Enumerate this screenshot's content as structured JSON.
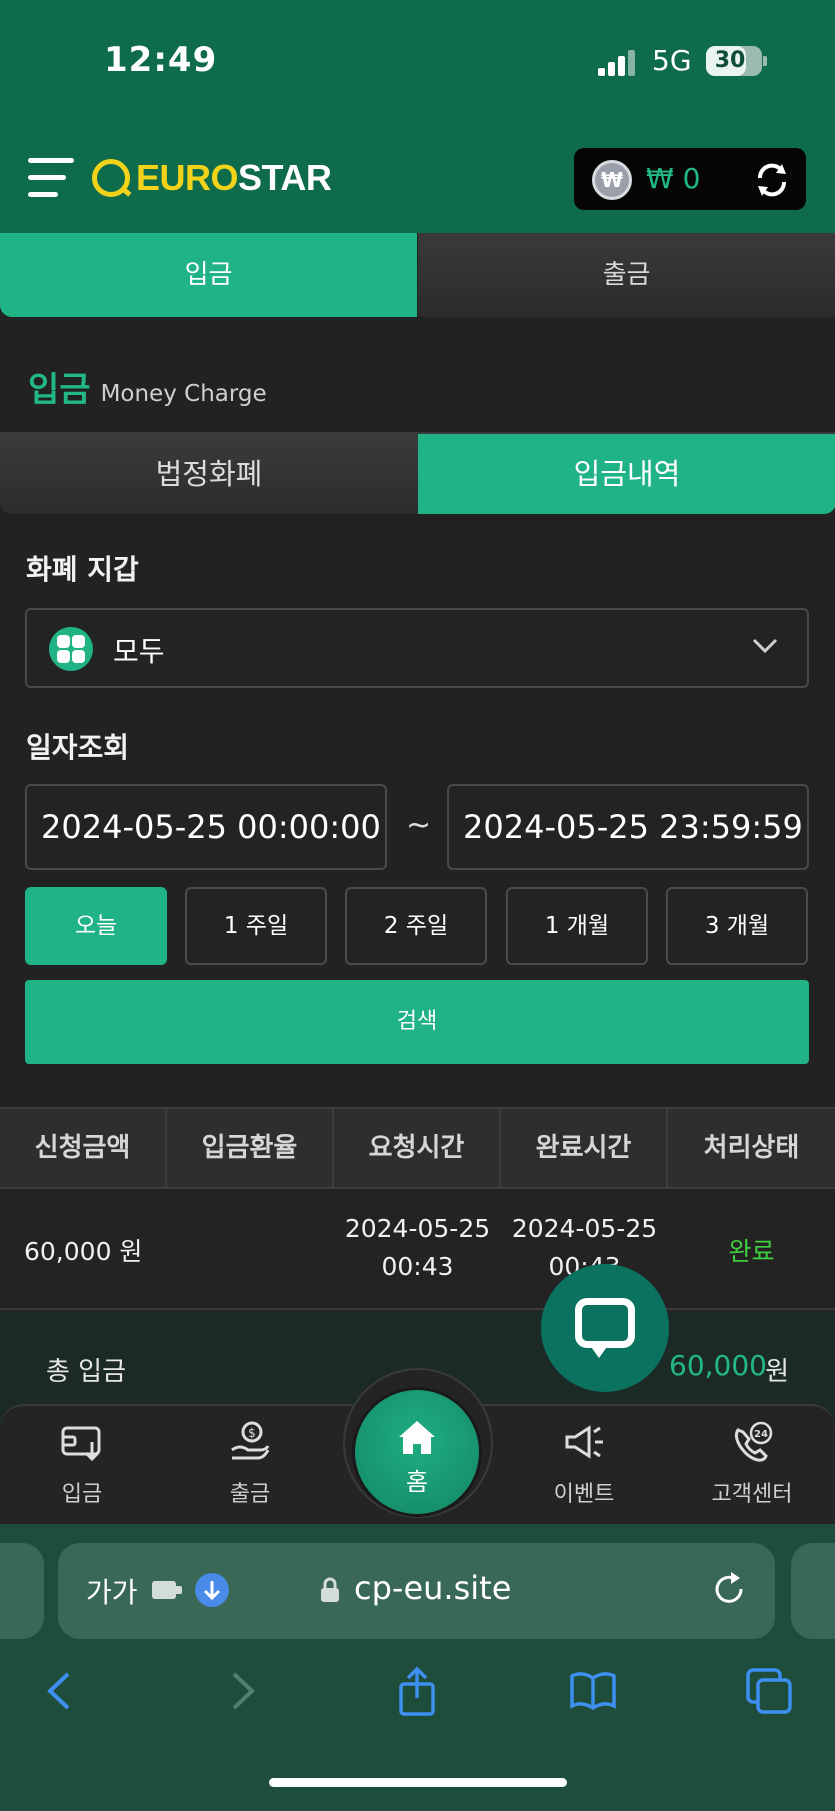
{
  "status_bar": {
    "time": "12:49",
    "network": "5G",
    "battery": "30"
  },
  "header": {
    "logo_part1": "EURO",
    "logo_part2": "STAR",
    "wallet_symbol": "₩",
    "wallet_balance": "₩ 0"
  },
  "tabs": {
    "deposit": "입금",
    "withdraw": "출금"
  },
  "section": {
    "title": "입금",
    "subtitle": "Money Charge"
  },
  "subtabs": {
    "fiat": "법정화폐",
    "history": "입금내역"
  },
  "filters": {
    "wallet_label": "화폐 지갑",
    "wallet_value": "모두",
    "date_label": "일자조회",
    "date_from": "2024-05-25 00:00:00",
    "date_to": "2024-05-25 23:59:59",
    "date_sep": "~",
    "ranges": [
      "오늘",
      "1 주일",
      "2 주일",
      "1 개월",
      "3 개월"
    ],
    "search": "검색"
  },
  "table": {
    "headers": [
      "신청금액",
      "입금환율",
      "요청시간",
      "완료시간",
      "처리상태"
    ],
    "rows": [
      {
        "amount": "60,000 원",
        "rate": "",
        "request_date": "2024-05-25",
        "request_time": "00:43",
        "complete_date": "2024-05-25",
        "complete_time": "00:43",
        "status": "완료"
      }
    ]
  },
  "total": {
    "label": "총 입금",
    "amount": "60,000",
    "unit": "원"
  },
  "bottom_nav": {
    "deposit": "입금",
    "withdraw": "출금",
    "home": "홈",
    "event": "이벤트",
    "support": "고객센터"
  },
  "browser": {
    "aa": "가가",
    "url": "cp-eu.site"
  },
  "colors": {
    "brand_green": "#1fb385",
    "header_green": "#0e6b4b",
    "logo_yellow": "#f2d31a",
    "status_done": "#3fcf3f"
  }
}
